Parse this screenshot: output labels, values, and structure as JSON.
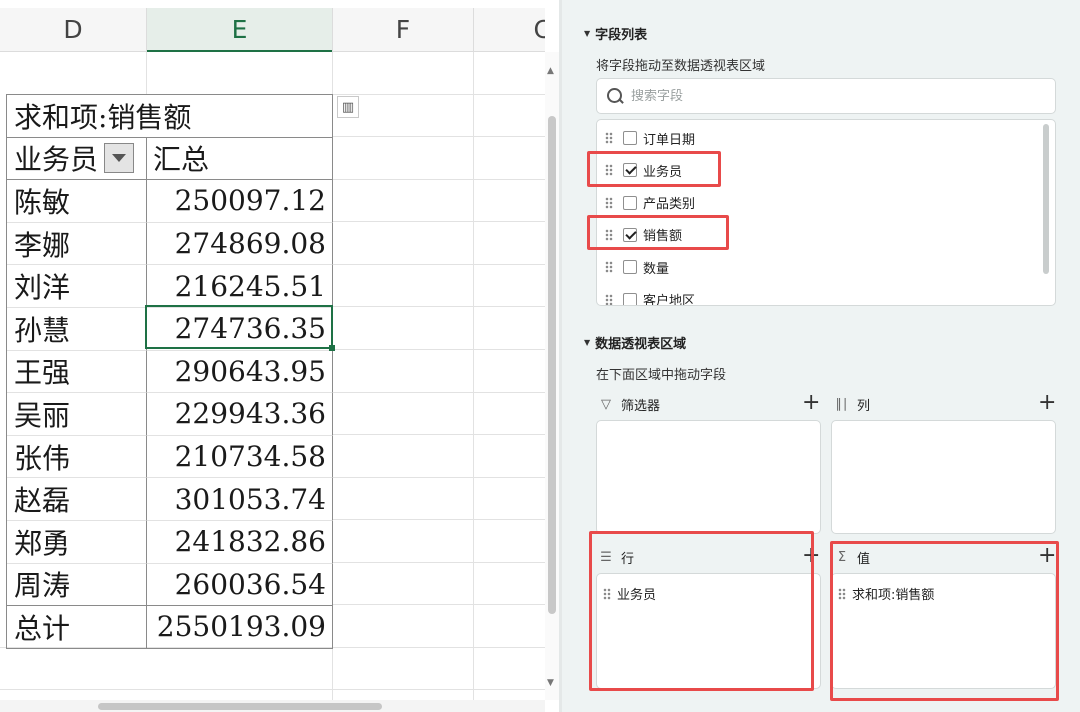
{
  "sheet": {
    "columns": [
      "D",
      "E",
      "F",
      "C"
    ],
    "selected_column": "E",
    "pivot": {
      "title": "求和项:销售额",
      "row_label": "业务员",
      "total_label": "汇总",
      "rows": [
        {
          "name": "陈敏",
          "value": "250097.12"
        },
        {
          "name": "李娜",
          "value": "274869.08"
        },
        {
          "name": "刘洋",
          "value": "216245.51"
        },
        {
          "name": "孙慧",
          "value": "274736.35"
        },
        {
          "name": "王强",
          "value": "290643.95"
        },
        {
          "name": "吴丽",
          "value": "229943.36"
        },
        {
          "name": "张伟",
          "value": "210734.58"
        },
        {
          "name": "赵磊",
          "value": "301053.74"
        },
        {
          "name": "郑勇",
          "value": "241832.86"
        },
        {
          "name": "周涛",
          "value": "260036.54"
        }
      ],
      "grand_total_label": "总计",
      "grand_total_value": "2550193.09"
    }
  },
  "panel": {
    "field_list_title": "字段列表",
    "field_list_hint": "将字段拖动至数据透视表区域",
    "search_placeholder": "搜索字段",
    "fields": [
      {
        "label": "订单日期",
        "checked": false
      },
      {
        "label": "业务员",
        "checked": true
      },
      {
        "label": "产品类别",
        "checked": false
      },
      {
        "label": "销售额",
        "checked": true
      },
      {
        "label": "数量",
        "checked": false
      },
      {
        "label": "客户地区",
        "checked": false
      }
    ],
    "areas_title": "数据透视表区域",
    "areas_hint": "在下面区域中拖动字段",
    "areas": {
      "filter": {
        "label": "筛选器",
        "items": []
      },
      "columns": {
        "label": "列",
        "items": []
      },
      "rows": {
        "label": "行",
        "items": [
          "业务员"
        ]
      },
      "values": {
        "label": "值",
        "items": [
          "求和项:销售额"
        ]
      }
    },
    "highlight_color": "#e84a4a"
  }
}
